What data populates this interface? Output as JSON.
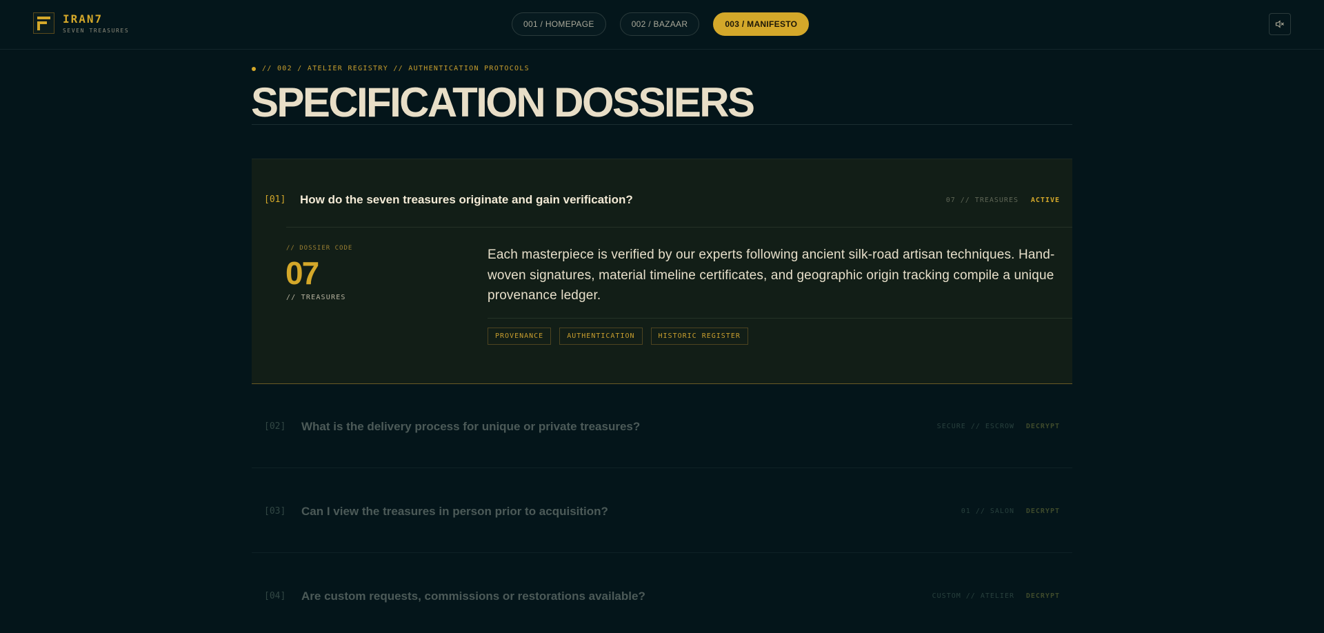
{
  "brand": {
    "name": "IRAN7",
    "subtitle": "SEVEN TREASURES"
  },
  "nav": {
    "items": [
      {
        "label": "001 / HOMEPAGE",
        "active": false
      },
      {
        "label": "002 / BAZAAR",
        "active": false
      },
      {
        "label": "003 / MANIFESTO",
        "active": true
      }
    ]
  },
  "sound": {
    "icon": "speaker-muted-icon"
  },
  "hero": {
    "kicker": "// 002 / ATELIER REGISTRY // AUTHENTICATION PROTOCOLS",
    "title": "SPECIFICATION DOSSIERS"
  },
  "faq": {
    "open": {
      "num": "[01]",
      "question": "How do the seven treasures originate and gain verification?",
      "meta": "07 // TREASURES",
      "state": "ACTIVE",
      "dossier_label": "// DOSSIER CODE",
      "dossier_code": "07",
      "dossier_unit": "// TREASURES",
      "answer": "Each masterpiece is verified by our experts following ancient silk-road artisan techniques. Hand-woven signatures, material timeline certificates, and geographic origin tracking compile a unique provenance ledger.",
      "tags": [
        "PROVENANCE",
        "AUTHENTICATION",
        "HISTORIC REGISTER"
      ]
    },
    "closed": [
      {
        "num": "[02]",
        "question": "What is the delivery process for unique or private treasures?",
        "meta": "SECURE // ESCROW",
        "state": "DECRYPT"
      },
      {
        "num": "[03]",
        "question": "Can I view the treasures in person prior to acquisition?",
        "meta": "01 // SALON",
        "state": "DECRYPT"
      },
      {
        "num": "[04]",
        "question": "Are custom requests, commissions or restorations available?",
        "meta": "CUSTOM // ATELIER",
        "state": "DECRYPT"
      }
    ]
  },
  "colors": {
    "background": "#04151a",
    "accent": "#d4a82a",
    "text": "#e8dec7"
  }
}
